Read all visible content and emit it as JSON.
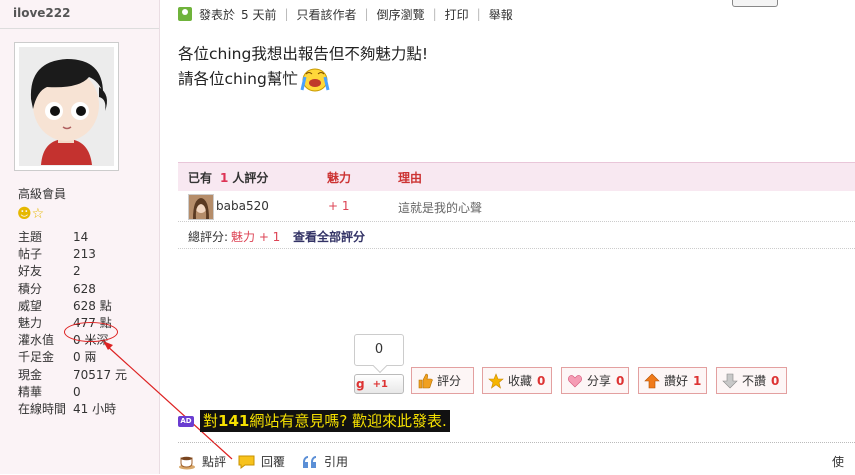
{
  "user": {
    "name": "ilove222",
    "rank": "高級會員",
    "stats": [
      {
        "label": "主題",
        "value": "14"
      },
      {
        "label": "帖子",
        "value": "213"
      },
      {
        "label": "好友",
        "value": "2"
      },
      {
        "label": "積分",
        "value": "628"
      },
      {
        "label": "威望",
        "value": "628 點"
      },
      {
        "label": "魅力",
        "value": "477 點"
      },
      {
        "label": "灌水值",
        "value": "0 米深"
      },
      {
        "label": "千足金",
        "value": "0 兩"
      },
      {
        "label": "現金",
        "value": "70517 元"
      },
      {
        "label": "精華",
        "value": "0"
      },
      {
        "label": "在線時間",
        "value": "41 小時"
      }
    ]
  },
  "post_bar": {
    "posted_label": "發表於",
    "posted_time": "5 天前",
    "only_author": "只看該作者",
    "reverse": "倒序瀏覽",
    "print": "打印",
    "report": "舉報"
  },
  "post": {
    "line1": "各位ching我想出報告但不夠魅力點!",
    "line2": "請各位ching幫忙"
  },
  "rating": {
    "header_prefix": "已有",
    "header_count": "1",
    "header_suffix": "人評分",
    "col_charm": "魅力",
    "col_reason": "理由",
    "rows": [
      {
        "user": "baba520",
        "points": "+ 1",
        "reason": "這就是我的心聲"
      }
    ],
    "total_label": "總評分:",
    "total_value": "魅力 + 1",
    "view_all": "查看全部評分"
  },
  "gplus": {
    "count": "0",
    "label": "+1",
    "g": "g"
  },
  "actions": [
    {
      "label": "評分",
      "count": ""
    },
    {
      "label": "收藏",
      "count": "0"
    },
    {
      "label": "分享",
      "count": "0"
    },
    {
      "label": "讚好",
      "count": "1"
    },
    {
      "label": "不讚",
      "count": "0"
    }
  ],
  "ad": {
    "tag": "AD",
    "text_prefix": "對",
    "text_num": "141",
    "text_rest": "網站有意見嗎? 歡迎來此發表."
  },
  "bottom": {
    "rate": "點評",
    "reply": "回覆",
    "quote": "引用",
    "cut": "使"
  },
  "colors": {
    "accent": "#d33333",
    "sidebar_bg": "#fbf3f6",
    "header_bg": "#f8e8f1"
  }
}
